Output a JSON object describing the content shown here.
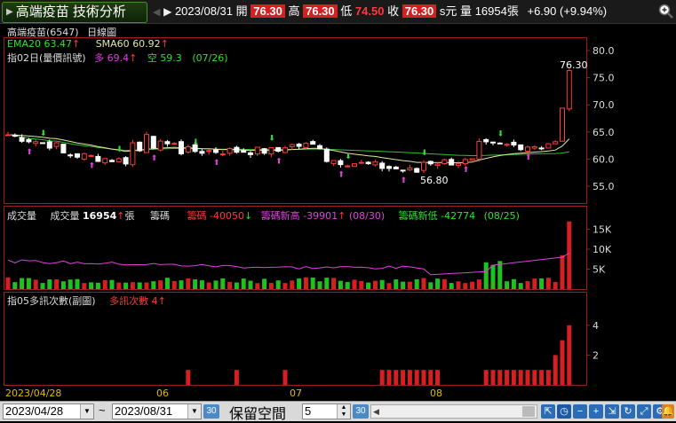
{
  "header": {
    "tab_title": "高端疫苗 技術分析",
    "date": "2023/08/31",
    "open_label": "開",
    "open": "76.30",
    "high_label": "高",
    "high": "76.30",
    "low_label": "低",
    "low": "74.50",
    "close_label": "收",
    "close": "76.30",
    "unit_suffix": "s元",
    "volume_label": "量",
    "volume": "16954",
    "volume_unit": "張",
    "change": "+6.90 (+9.94%)"
  },
  "price_panel": {
    "stock_name": "高端疫苗(6547)",
    "period": "日線圖",
    "ema_label": "EMA20",
    "ema_value": "63.47",
    "ema_arrow": "↑",
    "sma_label": "SMA60",
    "sma_value": "60.92",
    "sma_arrow": "↑",
    "indicator_label": "指02日(量價訊號)",
    "long_label": "多",
    "long_value": "69.4",
    "long_arrow": "↑",
    "short_label": "空",
    "short_value": "59.3",
    "short_date": "(07/26)",
    "high_annotation": "76.30",
    "low_annotation": "56.80",
    "y_ticks": [
      "80.0",
      "75.0",
      "70.0",
      "65.0",
      "60.0",
      "55.0"
    ],
    "colors": {
      "up": "#ff3a3a",
      "down": "#ffffff",
      "ema": "#e6e6a0",
      "sma": "#30c030",
      "long": "#e040e0",
      "short": "#30e030"
    }
  },
  "volume_panel": {
    "title": "成交量",
    "vol_label": "成交量",
    "vol_value": "16954",
    "vol_unit": "張",
    "chip_label": "籌碼",
    "chip1_label": "籌碼",
    "chip1_value": "-40050",
    "chip1_arrow": "↓",
    "chip2_label": "籌碼新高",
    "chip2_value": "-39901",
    "chip2_arrow": "↑",
    "chip2_date": "(08/30)",
    "chip3_label": "籌碼新低",
    "chip3_value": "-42774",
    "chip3_date": "(08/25)",
    "y_ticks": [
      "15K",
      "10K",
      "5K"
    ]
  },
  "signal_panel": {
    "indicator_label": "指05多訊次數(副圖)",
    "count_label": "多訊次數",
    "count_value": "4",
    "count_arrow": "↑",
    "y_ticks": [
      "4",
      "2"
    ]
  },
  "x_axis": {
    "labels": [
      "2023/04/28",
      "06",
      "07",
      "08"
    ]
  },
  "bottom_bar": {
    "start_date": "2023/04/28",
    "tilde": "~",
    "end_date": "2023/08/31",
    "btn30": "30",
    "reserve_label": "保留空間",
    "reserve_value": "5"
  },
  "chart_data": {
    "type": "candlestick",
    "x_range": [
      "2023/04/28",
      "2023/08/31"
    ],
    "ylim": [
      52,
      81
    ],
    "last": {
      "open": 76.3,
      "high": 76.3,
      "low": 74.5,
      "close": 76.3,
      "volume": 16954
    },
    "volume_ylim": [
      0,
      18000
    ],
    "signal_ylim": [
      0,
      5
    ]
  }
}
